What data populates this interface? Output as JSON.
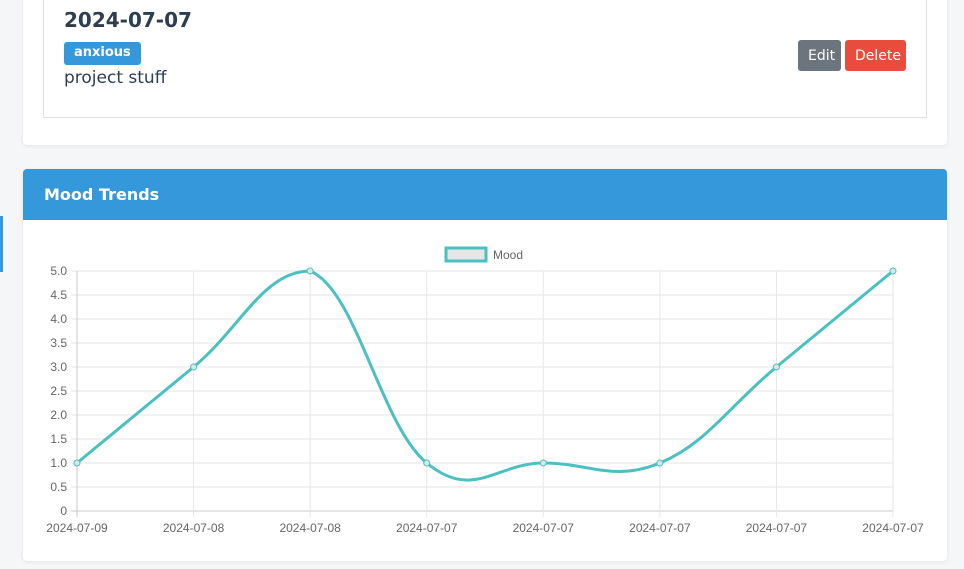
{
  "entry": {
    "date": "2024-07-07",
    "mood": "anxious",
    "note": "project stuff",
    "edit_label": "Edit",
    "delete_label": "Delete"
  },
  "chart_card": {
    "title": "Mood Trends"
  },
  "colors": {
    "accent": "#3498db",
    "line": "#4bc0c0",
    "edit": "#6c757d",
    "delete": "#e74c3c"
  },
  "chart_data": {
    "type": "line",
    "categories": [
      "2024-07-09",
      "2024-07-08",
      "2024-07-08",
      "2024-07-07",
      "2024-07-07",
      "2024-07-07",
      "2024-07-07",
      "2024-07-07"
    ],
    "series": [
      {
        "name": "Mood",
        "values": [
          1,
          3,
          5,
          1,
          1,
          1,
          3,
          5
        ]
      }
    ],
    "ylim": [
      0,
      5
    ],
    "yticks": [
      "0",
      "0.5",
      "1.0",
      "1.5",
      "2.0",
      "2.5",
      "3.0",
      "3.5",
      "4.0",
      "4.5",
      "5.0"
    ],
    "grid": true,
    "legend": "top"
  }
}
